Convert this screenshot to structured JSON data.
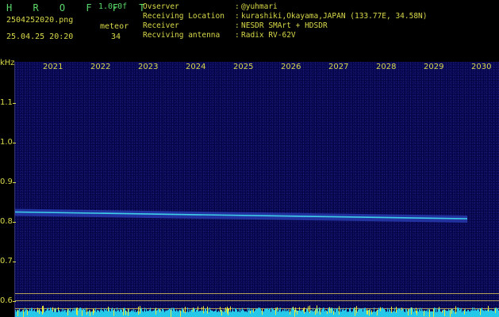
{
  "app": {
    "brand": "H R O F F T",
    "version": "1.0.0f"
  },
  "file": {
    "name": "2504252020.png",
    "datetime": "25.04.25 20:20"
  },
  "detection": {
    "mode": "meteor",
    "count": "34"
  },
  "station": [
    {
      "label": "Ovserver",
      "value": "@yuhmari"
    },
    {
      "label": "Receiving Location",
      "value": "kurashiki,Okayama,JAPAN (133.77E, 34.58N)"
    },
    {
      "label": "Receiver",
      "value": "NESDR SMArt + HDSDR"
    },
    {
      "label": "Recviving antenna",
      "value": "Radix RV-62V"
    }
  ],
  "axis": {
    "y_unit": "kHz",
    "y_ticks": [
      "1.1",
      "1.0",
      "0.9",
      "0.8",
      "0.7",
      "0.6"
    ],
    "x_labels": [
      "2021",
      "2022",
      "2023",
      "2024",
      "2025",
      "2026",
      "2027",
      "2028",
      "2029",
      "2030"
    ]
  },
  "signal": {
    "freq_start_khz": 0.825,
    "freq_end_khz": 0.808,
    "end_label_index": 8.75
  },
  "colors": {
    "accent_green": "#5bd86a",
    "text_yellow": "#d9d94a",
    "bg_blue": "#050549",
    "signal_cyan": "#3fd0e8",
    "noise_cyan": "#25c8e8",
    "noise_yellow": "#e8e83a"
  }
}
